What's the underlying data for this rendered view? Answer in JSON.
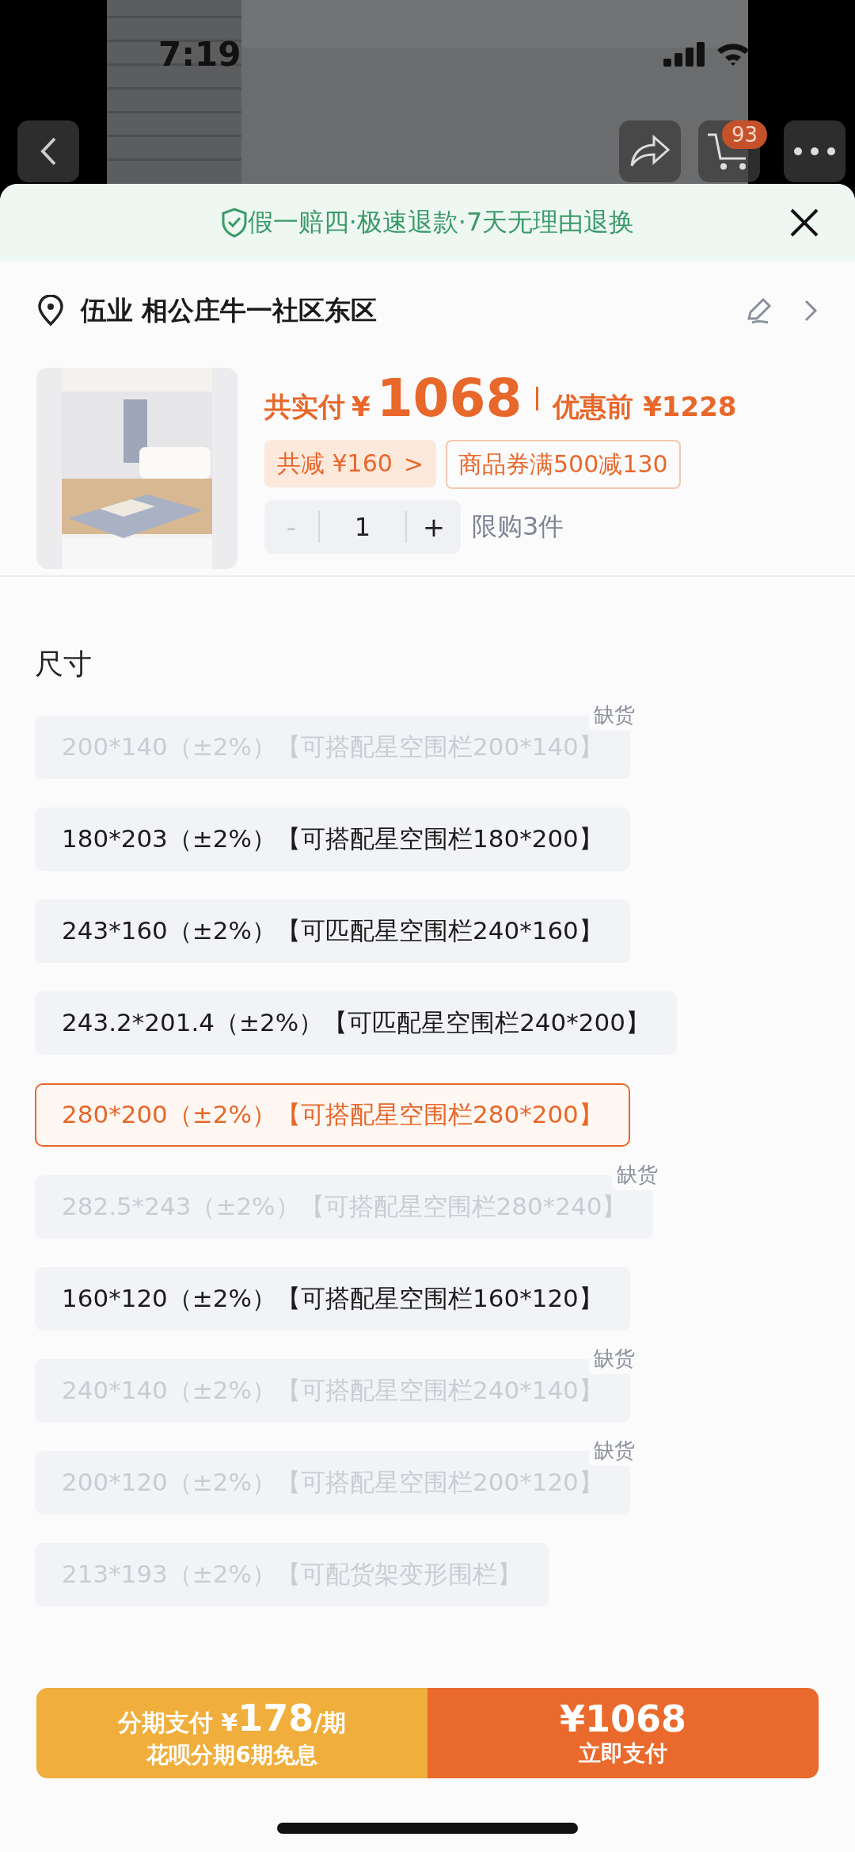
{
  "status_bar": {
    "time": "7:19"
  },
  "nav": {
    "cart_badge": "93"
  },
  "guarantee": {
    "text": "假一赔四·极速退款·7天无理由退换"
  },
  "address": {
    "text": "伍业 相公庄牛一社区东区"
  },
  "product": {
    "price_label": "共实付",
    "currency": "¥",
    "amount": "1068",
    "original_price": "优惠前 ¥1228",
    "discount": "共减 ¥160",
    "discount_arrow": ">",
    "coupon": "商品券满500减130",
    "quantity": {
      "minus": "-",
      "value": "1",
      "plus": "+",
      "minus_disabled": true,
      "limit": "限购3件"
    }
  },
  "section_title": "尺寸",
  "options": [
    {
      "label": "200*140（±2%）【可搭配星空围栏200*140】",
      "selected": false,
      "out_of_stock": true,
      "badge": "缺货"
    },
    {
      "label": "180*203（±2%）【可搭配星空围栏180*200】",
      "selected": false,
      "out_of_stock": false
    },
    {
      "label": "243*160（±2%）【可匹配星空围栏240*160】",
      "selected": false,
      "out_of_stock": false
    },
    {
      "label": "243.2*201.4（±2%）【可匹配星空围栏240*200】",
      "selected": false,
      "out_of_stock": false
    },
    {
      "label": "280*200（±2%）【可搭配星空围栏280*200】",
      "selected": true,
      "out_of_stock": false
    },
    {
      "label": "282.5*243（±2%）【可搭配星空围栏280*240】",
      "selected": false,
      "out_of_stock": true,
      "badge": "缺货"
    },
    {
      "label": "160*120（±2%）【可搭配星空围栏160*120】",
      "selected": false,
      "out_of_stock": false
    },
    {
      "label": "240*140（±2%）【可搭配星空围栏240*140】",
      "selected": false,
      "out_of_stock": true,
      "badge": "缺货"
    },
    {
      "label": "200*120（±2%）【可搭配星空围栏200*120】",
      "selected": false,
      "out_of_stock": true,
      "badge": "缺货"
    },
    {
      "label": "213*193（±2%）【可配货架变形围栏】",
      "selected": false,
      "out_of_stock": true
    }
  ],
  "bottom_bar": {
    "installment_prefix": "分期支付 ¥",
    "installment_amount": "178",
    "installment_suffix": "/期",
    "installment_note": "花呗分期6期免息",
    "pay_amount": "¥1068",
    "pay_label": "立即支付"
  }
}
